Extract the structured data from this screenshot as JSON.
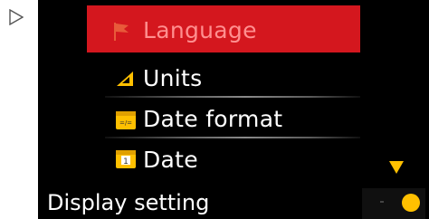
{
  "menu": {
    "items": [
      {
        "label": "Language",
        "icon": "flag-icon",
        "selected": true
      },
      {
        "label": "Units",
        "icon": "ruler-triangle-icon",
        "selected": false
      },
      {
        "label": "Date format",
        "icon": "date-format-icon",
        "selected": false
      },
      {
        "label": "Date",
        "icon": "calendar-icon",
        "selected": false
      }
    ],
    "scroll_indicator": "scroll-down-arrow-icon"
  },
  "footer": {
    "title": "Display setting",
    "status_icon": "status-dot-icon"
  },
  "colors": {
    "selected_bg": "#d4171e",
    "selected_text": "#ff8f8f",
    "text": "#ffffff",
    "accent": "#ffc000",
    "screen_bg": "#000000"
  }
}
